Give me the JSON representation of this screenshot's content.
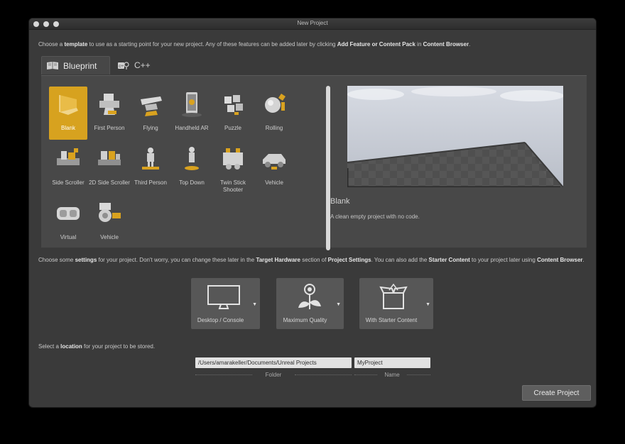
{
  "window": {
    "title": "New Project"
  },
  "intro": {
    "part1": "Choose a ",
    "bold1": "template",
    "part2": " to use as a starting point for your new project.  Any of these features can be added later by clicking ",
    "bold2": "Add Feature or Content Pack",
    "part3": " in ",
    "bold3": "Content Browser",
    "part4": "."
  },
  "tabs": [
    {
      "label": "Blueprint",
      "icon": "blueprint-icon",
      "active": true
    },
    {
      "label": "C++",
      "icon": "cpp-icon",
      "active": false
    }
  ],
  "templates": [
    {
      "label": "Blank",
      "selected": true
    },
    {
      "label": "First Person"
    },
    {
      "label": "Flying"
    },
    {
      "label": "Handheld AR"
    },
    {
      "label": "Puzzle"
    },
    {
      "label": "Rolling"
    },
    {
      "label": "Side Scroller"
    },
    {
      "label": "2D Side Scroller"
    },
    {
      "label": "Third Person"
    },
    {
      "label": "Top Down"
    },
    {
      "label": "Twin Stick Shooter"
    },
    {
      "label": "Vehicle"
    },
    {
      "label": "Virtual"
    },
    {
      "label": "Vehicle"
    }
  ],
  "preview": {
    "name": "Blank",
    "description": "A clean empty project with no code."
  },
  "settings_intro": {
    "part1": "Choose some ",
    "bold1": "settings",
    "part2": " for your project.  Don't worry, you can change these later in the ",
    "bold2": "Target Hardware",
    "part3": " section of ",
    "bold3": "Project Settings",
    "part4": ".  You can also add the ",
    "bold4": "Starter Content",
    "part5": " to your project later using ",
    "bold5": "Content Browser",
    "part6": "."
  },
  "settings": [
    {
      "label": "Desktop / Console",
      "icon": "monitor-icon"
    },
    {
      "label": "Maximum Quality",
      "icon": "quality-flower-icon"
    },
    {
      "label": "With Starter Content",
      "icon": "starter-box-icon"
    }
  ],
  "location_intro": {
    "part1": "Select a ",
    "bold1": "location",
    "part2": " for your project to be stored."
  },
  "location": {
    "folder_value": "/Users/amarakeller/Documents/Unreal Projects",
    "folder_caption": "Folder",
    "name_value": "MyProject",
    "name_caption": "Name"
  },
  "create_button": "Create Project",
  "colors": {
    "accent": "#d7a21f",
    "background": "#3a3a3a",
    "panel": "#484848"
  }
}
